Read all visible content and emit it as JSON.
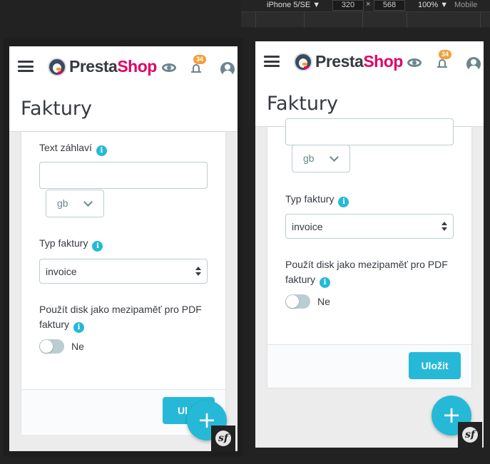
{
  "devtools": {
    "device": "iPhone 5/SE",
    "device_caret": "▼",
    "width": "320",
    "times": "×",
    "height": "568",
    "zoom": "100%",
    "zoom_caret": "▼",
    "mode": "Mobile"
  },
  "app": {
    "logo_part1": "Presta",
    "logo_part2": "Shop",
    "notifications_count": "34",
    "page_title": "Faktury"
  },
  "form": {
    "header_text_label": "Text záhlaví",
    "info_glyph": "i",
    "language": "gb",
    "invoice_type_label": "Typ faktury",
    "invoice_type_value": "invoice",
    "disk_cache_label": "Použít disk jako mezipaměť pro PDF faktury",
    "disk_cache_value": "Ne",
    "save_label": "Uložit",
    "save_label_clipped": "Ul"
  },
  "fab_glyph": "+",
  "symfony_glyph": "sf",
  "colors": {
    "accent": "#25b9d7",
    "brand_pink": "#df0067",
    "badge": "#f2a03c",
    "text": "#363a41"
  }
}
